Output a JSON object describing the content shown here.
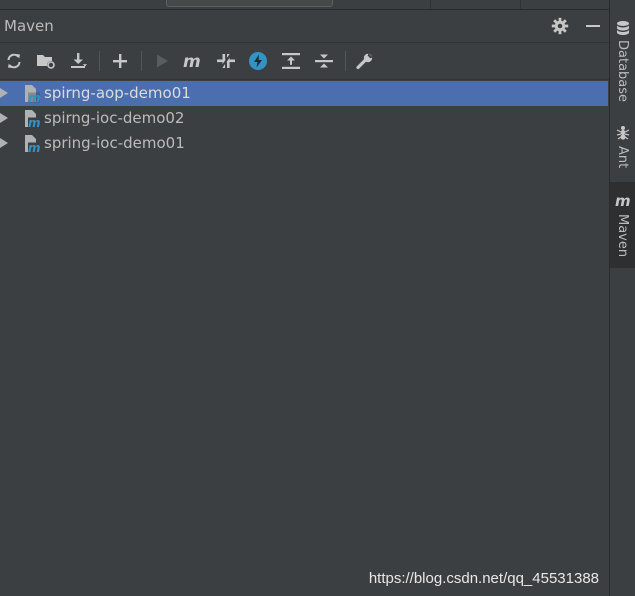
{
  "panel": {
    "title": "Maven"
  },
  "header_actions": [
    {
      "icon": "gear-icon"
    },
    {
      "icon": "minimize-icon"
    }
  ],
  "toolbar": {
    "buttons": [
      {
        "icon": "reload-icon",
        "enabled": true
      },
      {
        "icon": "add-folder-icon",
        "enabled": true
      },
      {
        "icon": "download-icon",
        "enabled": true
      },
      {
        "icon": "plus-icon",
        "enabled": true
      },
      {
        "icon": "run-icon",
        "enabled": false
      },
      {
        "icon": "maven-goal-icon",
        "enabled": true
      },
      {
        "icon": "toggle-offline-icon",
        "enabled": true
      },
      {
        "icon": "skip-tests-icon",
        "enabled": true
      },
      {
        "icon": "expand-all-icon",
        "enabled": true
      },
      {
        "icon": "collapse-all-icon",
        "enabled": true
      },
      {
        "icon": "wrench-icon",
        "enabled": true
      }
    ]
  },
  "tree": {
    "items": [
      {
        "label": "spirng-aop-demo01",
        "selected": true
      },
      {
        "label": "spirng-ioc-demo02",
        "selected": false
      },
      {
        "label": "spring-ioc-demo01",
        "selected": false
      }
    ]
  },
  "side_tabs": [
    {
      "label": "Database",
      "icon": "database-icon",
      "active": false
    },
    {
      "label": "Ant",
      "icon": "ant-icon",
      "active": false
    },
    {
      "label": "Maven",
      "icon": "maven-icon",
      "active": true
    }
  ],
  "watermark": "https://blog.csdn.net/qq_45531388",
  "colors": {
    "panel_bg": "#3c3f41",
    "selection": "#4b6eaf",
    "text": "#bbbbbb",
    "accent_blue": "#3592c4"
  }
}
